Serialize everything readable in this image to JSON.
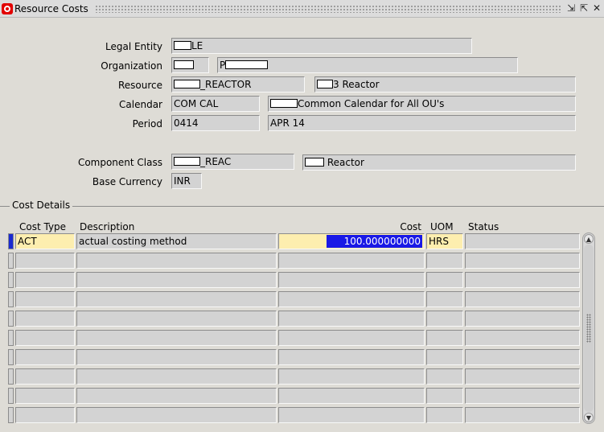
{
  "window": {
    "title": "Resource Costs",
    "controls": {
      "minimize": "⇲",
      "maximize": "⇱",
      "close": "✕"
    }
  },
  "header": {
    "legal_entity": {
      "label": "Legal Entity",
      "value": "LE"
    },
    "organization": {
      "label": "Organization",
      "code": "",
      "name": "P"
    },
    "resource": {
      "label": "Resource",
      "code": "_REACTOR",
      "name": "3 Reactor"
    },
    "calendar": {
      "label": "Calendar",
      "code": "COM CAL",
      "name": "Common Calendar for All OU's"
    },
    "period": {
      "label": "Period",
      "code": "0414",
      "name": "APR 14"
    },
    "component_class": {
      "label": "Component Class",
      "code": "_REAC",
      "name": "Reactor"
    },
    "base_currency": {
      "label": "Base Currency",
      "value": "INR"
    }
  },
  "cost_details": {
    "section_title": "Cost Details",
    "columns": {
      "cost_type": "Cost Type",
      "description": "Description",
      "cost": "Cost",
      "uom": "UOM",
      "status": "Status"
    },
    "rows": [
      {
        "cost_type": "ACT",
        "description": "actual costing method",
        "cost": "100.000000000",
        "uom": "HRS",
        "status": ""
      },
      {
        "cost_type": "",
        "description": "",
        "cost": "",
        "uom": "",
        "status": ""
      },
      {
        "cost_type": "",
        "description": "",
        "cost": "",
        "uom": "",
        "status": ""
      },
      {
        "cost_type": "",
        "description": "",
        "cost": "",
        "uom": "",
        "status": ""
      },
      {
        "cost_type": "",
        "description": "",
        "cost": "",
        "uom": "",
        "status": ""
      },
      {
        "cost_type": "",
        "description": "",
        "cost": "",
        "uom": "",
        "status": ""
      },
      {
        "cost_type": "",
        "description": "",
        "cost": "",
        "uom": "",
        "status": ""
      },
      {
        "cost_type": "",
        "description": "",
        "cost": "",
        "uom": "",
        "status": ""
      },
      {
        "cost_type": "",
        "description": "",
        "cost": "",
        "uom": "",
        "status": ""
      },
      {
        "cost_type": "",
        "description": "",
        "cost": "",
        "uom": "",
        "status": ""
      }
    ]
  },
  "colors": {
    "background": "#dedcd6",
    "field": "#d3d3d3",
    "required_field": "#fdeeaf",
    "selection": "#1919e6",
    "title_icon": "#e20000"
  }
}
